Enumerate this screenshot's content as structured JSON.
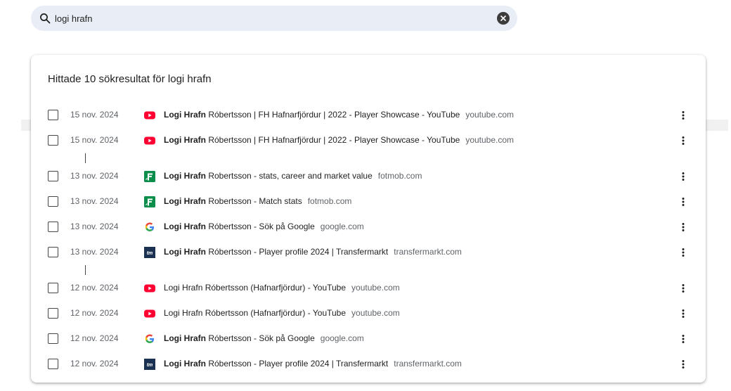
{
  "search": {
    "value": "logi hrafn"
  },
  "results": {
    "heading": "Hittade 10 sökresultat för logi hrafn",
    "rows": [
      {
        "date": "15 nov. 2024",
        "icon": "youtube-icon",
        "title_bold": "Logi Hrafn",
        "title_rest": " Róbertsson | FH Hafnarfjördur | 2022 - Player Showcase - YouTube",
        "domain": "youtube.com"
      },
      {
        "date": "15 nov. 2024",
        "icon": "youtube-icon",
        "title_bold": "Logi Hrafn",
        "title_rest": " Róbertsson | FH Hafnarfjördur | 2022 - Player Showcase - YouTube",
        "domain": "youtube.com"
      },
      {
        "date": "13 nov. 2024",
        "icon": "fotmob-icon",
        "title_bold": "Logi Hrafn",
        "title_rest": " Robertsson - stats, career and market value",
        "domain": "fotmob.com"
      },
      {
        "date": "13 nov. 2024",
        "icon": "fotmob-icon",
        "title_bold": "Logi Hrafn",
        "title_rest": " Robertsson - Match stats",
        "domain": "fotmob.com"
      },
      {
        "date": "13 nov. 2024",
        "icon": "google-icon",
        "title_bold": "Logi Hrafn",
        "title_rest": " Róbertsson - Sök på Google",
        "domain": "google.com"
      },
      {
        "date": "13 nov. 2024",
        "icon": "transfermarkt-icon",
        "title_bold": "Logi Hrafn",
        "title_rest": " Róbertsson - Player profile 2024 | Transfermarkt",
        "domain": "transfermarkt.com"
      },
      {
        "date": "12 nov. 2024",
        "icon": "youtube-icon",
        "title_bold": "",
        "title_rest": "Logi Hrafn Róbertsson (Hafnarfjördur) - YouTube",
        "domain": "youtube.com"
      },
      {
        "date": "12 nov. 2024",
        "icon": "youtube-icon",
        "title_bold": "",
        "title_rest": "Logi Hrafn Róbertsson (Hafnarfjördur) - YouTube",
        "domain": "youtube.com"
      },
      {
        "date": "12 nov. 2024",
        "icon": "google-icon",
        "title_bold": "Logi Hrafn",
        "title_rest": " Róbertsson - Sök på Google",
        "domain": "google.com"
      },
      {
        "date": "12 nov. 2024",
        "icon": "transfermarkt-icon",
        "title_bold": "Logi Hrafn",
        "title_rest": " Róbertsson - Player profile 2024 | Transfermarkt",
        "domain": "transfermarkt.com"
      }
    ]
  },
  "colors": {
    "youtube": "#ff0033",
    "fotmob": "#0b8e4b",
    "transfermarkt": "#1a3151",
    "search_bg": "#e9eef6"
  }
}
